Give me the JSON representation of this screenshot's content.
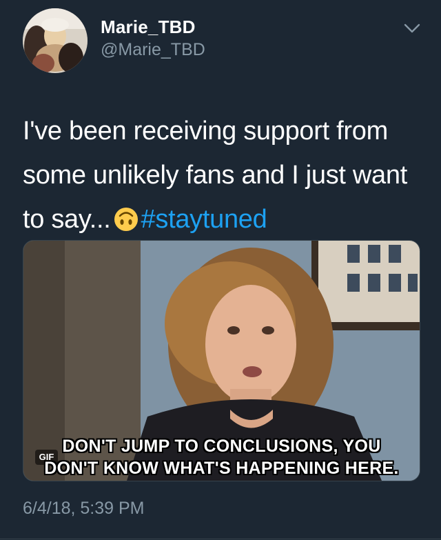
{
  "author": {
    "display_name": "Marie_TBD",
    "handle": "@Marie_TBD",
    "avatar_icon": "profile-photo",
    "menu_icon": "chevron-down-icon"
  },
  "tweet": {
    "text_before_emoji": "I've been receiving support from some unlikely fans and I just want to say...",
    "emoji": "upside-down-face-emoji",
    "hashtag": "#staytuned",
    "timestamp": "6/4/18, 5:39 PM"
  },
  "media": {
    "type": "gif",
    "badge": "GIF",
    "caption_line_1": "DON'T JUMP TO CONCLUSIONS, YOU",
    "caption_line_2": "DON'T KNOW WHAT'S HAPPENING HERE."
  },
  "colors": {
    "background": "#1c2733",
    "primary_text": "#ffffff",
    "secondary_text": "#8899a6",
    "link": "#1da1f2"
  }
}
